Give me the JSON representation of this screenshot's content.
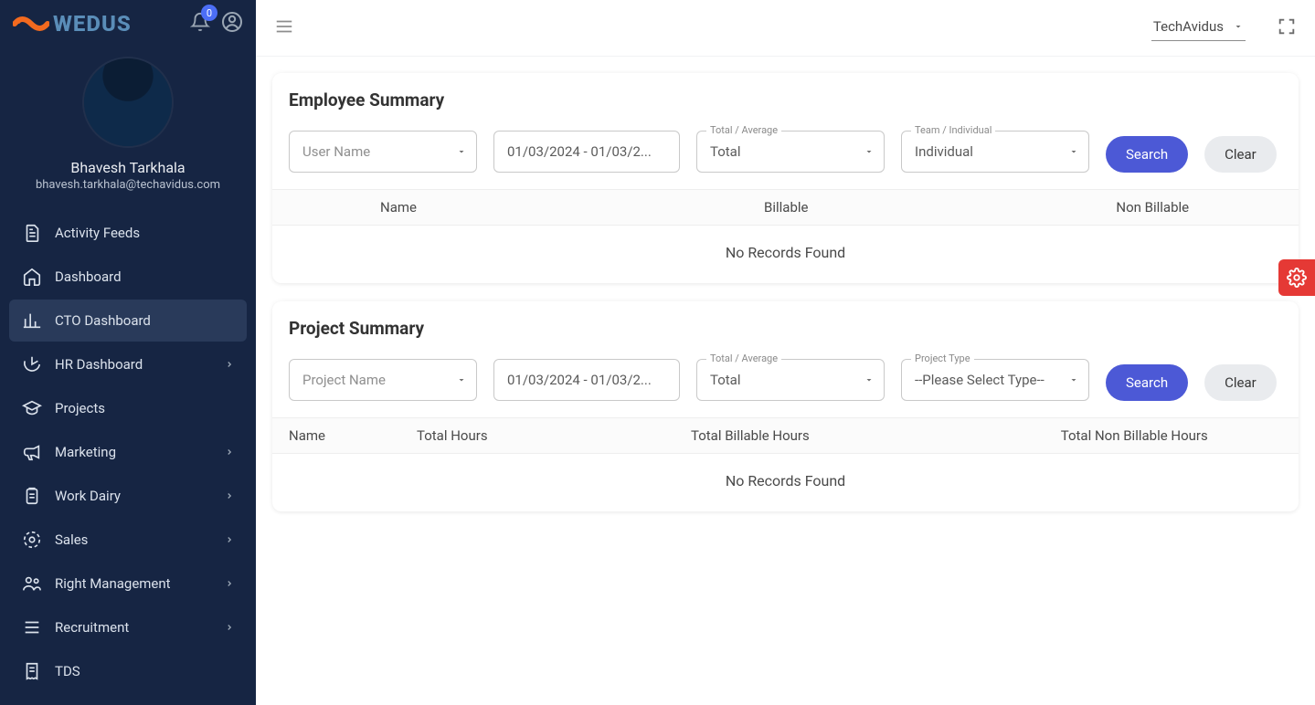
{
  "brand": {
    "name": "WEDUS"
  },
  "notifications": {
    "count": "0"
  },
  "user": {
    "name": "Bhavesh Tarkhala",
    "email": "bhavesh.tarkhala@techavidus.com"
  },
  "tenant": {
    "name": "TechAvidus"
  },
  "sidebar": {
    "items": [
      {
        "label": "Activity Feeds",
        "expandable": false
      },
      {
        "label": "Dashboard",
        "expandable": false
      },
      {
        "label": "CTO Dashboard",
        "expandable": false,
        "active": true
      },
      {
        "label": "HR Dashboard",
        "expandable": true
      },
      {
        "label": "Projects",
        "expandable": false
      },
      {
        "label": "Marketing",
        "expandable": true
      },
      {
        "label": "Work Dairy",
        "expandable": true
      },
      {
        "label": "Sales",
        "expandable": true
      },
      {
        "label": "Right Management",
        "expandable": true
      },
      {
        "label": "Recruitment",
        "expandable": true
      },
      {
        "label": "TDS",
        "expandable": false
      }
    ]
  },
  "employee_summary": {
    "title": "Employee Summary",
    "username_placeholder": "User Name",
    "date_range": "01/03/2024 - 01/03/2...",
    "total_avg_label": "Total / Average",
    "total_avg_value": "Total",
    "team_ind_label": "Team / Individual",
    "team_ind_value": "Individual",
    "search": "Search",
    "clear": "Clear",
    "columns": {
      "name": "Name",
      "billable": "Billable",
      "non_billable": "Non Billable"
    },
    "empty": "No Records Found"
  },
  "project_summary": {
    "title": "Project Summary",
    "project_placeholder": "Project Name",
    "date_range": "01/03/2024 - 01/03/2...",
    "total_avg_label": "Total / Average",
    "total_avg_value": "Total",
    "type_label": "Project Type",
    "type_value": "--Please Select Type--",
    "search": "Search",
    "clear": "Clear",
    "columns": {
      "name": "Name",
      "total_hours": "Total Hours",
      "billable": "Total Billable Hours",
      "non_billable": "Total Non Billable Hours"
    },
    "empty": "No Records Found"
  }
}
